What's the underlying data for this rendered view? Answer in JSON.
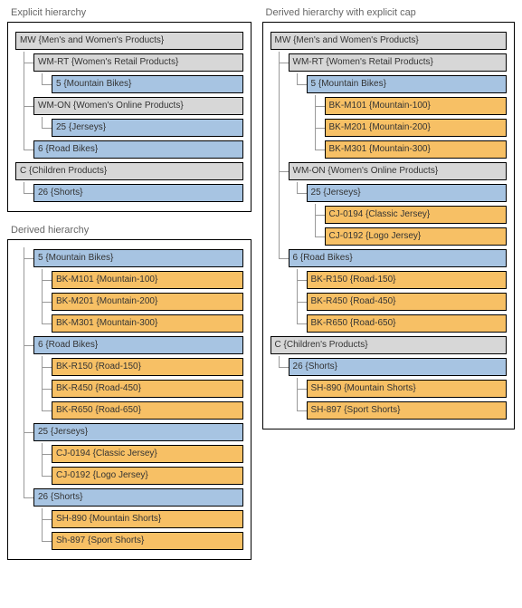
{
  "titles": {
    "explicit": "Explicit hierarchy",
    "derived": "Derived hierarchy",
    "derived_cap": "Derived hierarchy with explicit cap"
  },
  "explicit": {
    "n0": "MW {Men's and Women's Products}",
    "n1": "WM-RT {Women's Retail Products}",
    "n2": "5 {Mountain Bikes}",
    "n3": "WM-ON {Women's Online Products}",
    "n4": "25 {Jerseys}",
    "n5": "6 {Road Bikes}",
    "n6": "C {Children Products}",
    "n7": "26 {Shorts}"
  },
  "derived": {
    "n0": "5 {Mountain Bikes}",
    "n1": "BK-M101 {Mountain-100}",
    "n2": "BK-M201 {Mountain-200}",
    "n3": "BK-M301 {Mountain-300}",
    "n4": "6 {Road Bikes}",
    "n5": "BK-R150 {Road-150}",
    "n6": "BK-R450 {Road-450}",
    "n7": "BK-R650 {Road-650}",
    "n8": "25 {Jerseys}",
    "n9": "CJ-0194 {Classic Jersey}",
    "n10": "CJ-0192 {Logo Jersey}",
    "n11": "26 {Shorts}",
    "n12": "SH-890 {Mountain Shorts}",
    "n13": "Sh-897 {Sport Shorts}"
  },
  "derived_cap": {
    "n0": "MW {Men's and Women's Products}",
    "n1": "WM-RT {Women's Retail Products}",
    "n2": "5 {Mountain Bikes}",
    "n3": "BK-M101 {Mountain-100}",
    "n4": "BK-M201 {Mountain-200}",
    "n5": "BK-M301 {Mountain-300}",
    "n6": "WM-ON {Women's Online Products}",
    "n7": "25 {Jerseys}",
    "n8": "CJ-0194 {Classic Jersey}",
    "n9": "CJ-0192 {Logo Jersey}",
    "n10": "6 {Road Bikes}",
    "n11": "BK-R150 {Road-150}",
    "n12": "BK-R450 {Road-450}",
    "n13": "BK-R650 {Road-650}",
    "n14": "C {Children's Products}",
    "n15": "26 {Shorts}",
    "n16": "SH-890 {Mountain Shorts}",
    "n17": "SH-897 {Sport Shorts}"
  }
}
